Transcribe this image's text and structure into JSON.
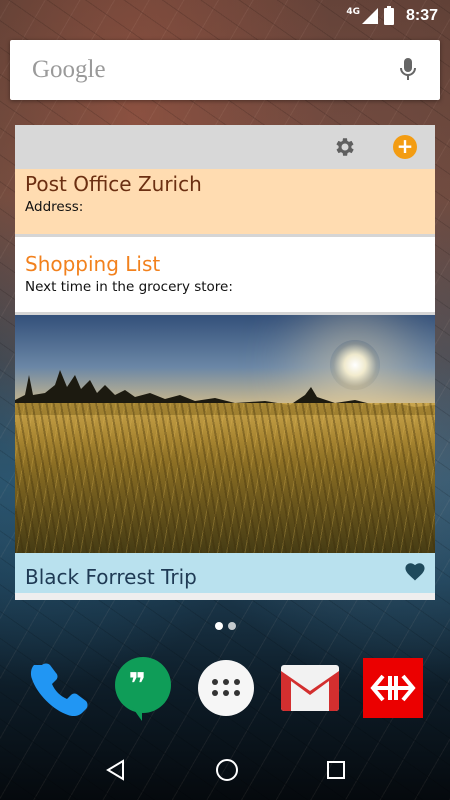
{
  "status_bar": {
    "network": "4G",
    "time": "8:37"
  },
  "search": {
    "logo_text": "Google",
    "mic_icon": "microphone-icon"
  },
  "widget": {
    "toolbar": {
      "settings_icon": "gear-icon",
      "add_icon": "add-circle-icon",
      "add_glyph": "+",
      "accent_color": "#f39c12"
    },
    "notes": [
      {
        "title": "Post Office Zurich",
        "body": "Address:",
        "background": "#ffdcb1",
        "title_color": "#6b2f12"
      },
      {
        "title": "Shopping List",
        "body": "Next time in the grocery store:",
        "background": "#ffffff",
        "title_color": "#f2811d"
      }
    ],
    "photo_card": {
      "caption": "Black Forrest Trip",
      "caption_background": "#b9e1ee",
      "favorite_icon": "heart-icon"
    }
  },
  "page_indicator": {
    "pages": 2,
    "current": 1
  },
  "dock": {
    "apps": [
      {
        "name": "Phone",
        "icon": "phone-icon"
      },
      {
        "name": "Hangouts",
        "icon": "hangouts-icon"
      },
      {
        "name": "Apps",
        "icon": "app-drawer-icon"
      },
      {
        "name": "Gmail",
        "icon": "gmail-icon"
      },
      {
        "name": "SBB",
        "icon": "sbb-icon"
      }
    ]
  },
  "nav_bar": {
    "back": "back-icon",
    "home": "home-icon",
    "recents": "recents-icon"
  }
}
